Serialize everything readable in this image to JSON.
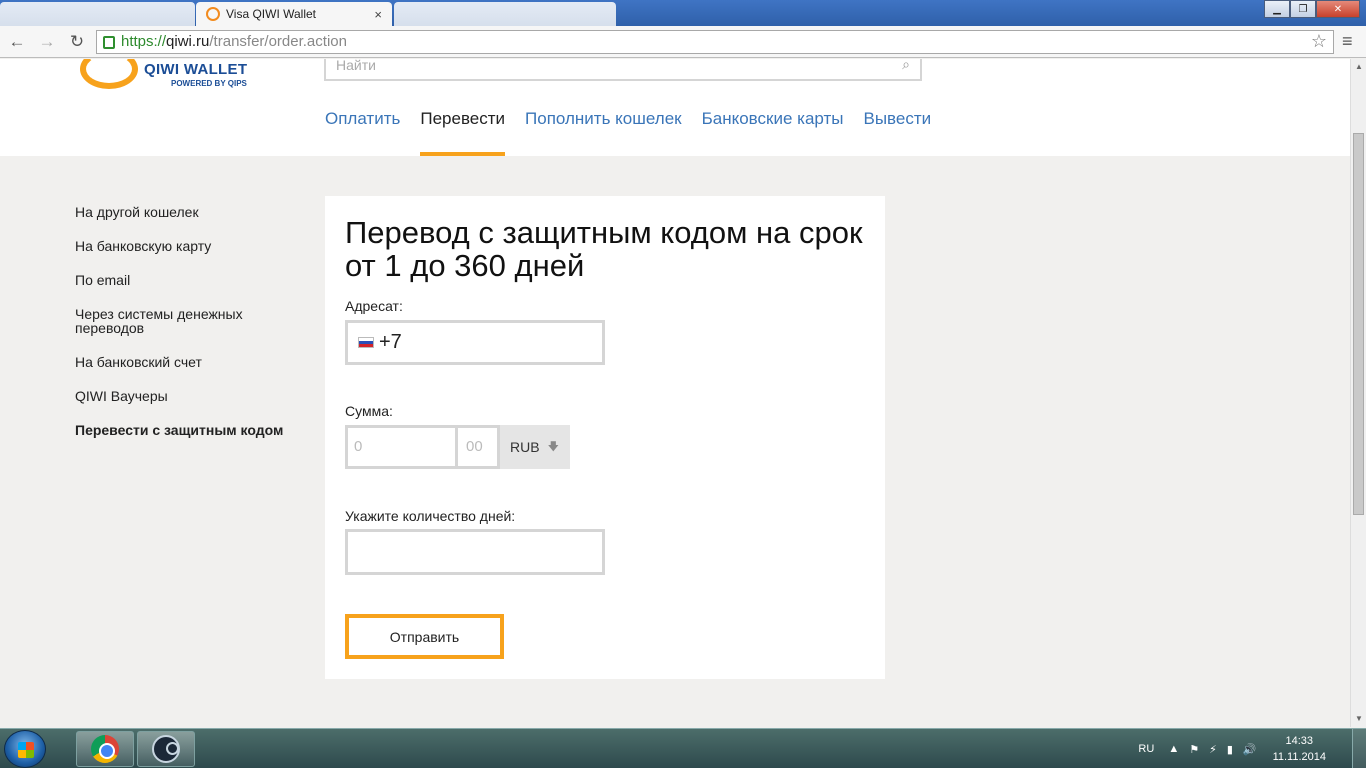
{
  "browser": {
    "active_tab_title": "Visa QIWI Wallet",
    "tab_close": "×",
    "url_scheme": "https://",
    "url_host": "qiwi.ru",
    "url_path": "/transfer/order.action",
    "window_buttons": {
      "minimize": "▁",
      "maximize": "❐",
      "close": "✕"
    },
    "icons": {
      "back": "←",
      "forward": "→",
      "reload": "↻",
      "star": "☆",
      "menu": "≡"
    }
  },
  "header": {
    "logo_text": "QIWI WALLET",
    "logo_sub": "POWERED BY QIPS",
    "search_placeholder": "Найти",
    "search_icon": "⌕",
    "nav": [
      "Оплатить",
      "Перевести",
      "Пополнить кошелек",
      "Банковские карты",
      "Вывести"
    ],
    "nav_active_index": 1
  },
  "sidenav": {
    "items": [
      "На другой кошелек",
      "На банковскую карту",
      "По email",
      "Через системы денежных переводов",
      "На банковский счет",
      "QIWI Ваучеры",
      "Перевести с защитным кодом"
    ],
    "active_index": 6
  },
  "form": {
    "title": "Перевод с защитным кодом на срок от 1 до 360 дней",
    "recipient_label": "Адресат:",
    "phone_prefix": "+7",
    "amount_label": "Сумма:",
    "amount_int_placeholder": "0",
    "amount_dec_placeholder": "00",
    "currency": "RUB",
    "currency_arrow": "🡇",
    "days_label": "Укажите количество дней:",
    "days_value": "",
    "submit_label": "Отправить"
  },
  "scrollbar": {
    "up": "▲",
    "down": "▼"
  },
  "taskbar": {
    "language": "RU",
    "tray_icons": [
      "▲",
      "⚑",
      "⚡",
      "▮",
      "🔊"
    ],
    "time": "14:33",
    "date": "11.11.2014"
  },
  "colors": {
    "accent": "#f7a21c",
    "link": "#3a75b8",
    "brand_blue": "#1b4d96",
    "page_bg": "#f1f0ee"
  }
}
